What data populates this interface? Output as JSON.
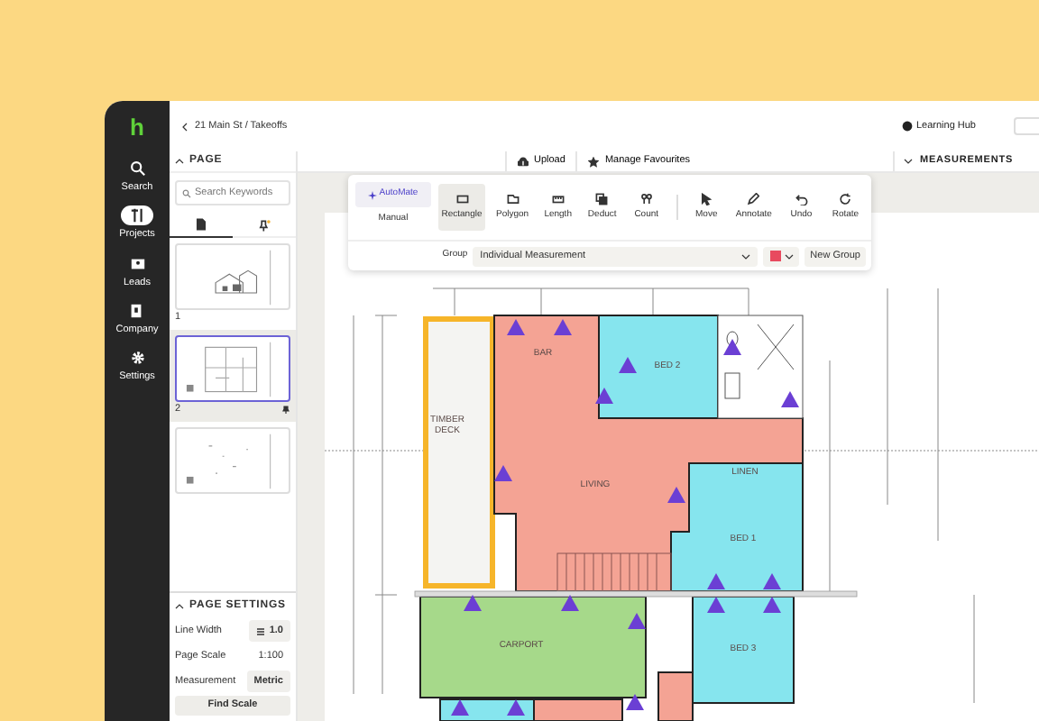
{
  "logo": "h",
  "nav": [
    {
      "label": "Search",
      "kind": "search",
      "selected": false
    },
    {
      "label": "Projects",
      "kind": "projects",
      "selected": true
    },
    {
      "label": "Leads",
      "kind": "leads",
      "selected": false
    },
    {
      "label": "Company",
      "kind": "company",
      "selected": false
    },
    {
      "label": "Settings",
      "kind": "settings",
      "selected": false
    }
  ],
  "header": {
    "breadcrumb": "21 Main St / Takeoffs",
    "help": "Learning Hub"
  },
  "page_panel": {
    "title": "PAGE",
    "search_placeholder": "Search Keywords",
    "tabs": [
      {
        "kind": "pages",
        "selected": true
      },
      {
        "kind": "pins",
        "selected": false
      }
    ],
    "pages": [
      {
        "number": "1",
        "kind": "elevation",
        "selected": false,
        "pinned": false
      },
      {
        "number": "2",
        "kind": "plan",
        "selected": true,
        "pinned": true
      },
      {
        "kind": "sparse",
        "selected": false,
        "pinned": false
      }
    ]
  },
  "page_settings": {
    "title": "PAGE SETTINGS",
    "rows": [
      {
        "label": "Line Width",
        "value": "1.0",
        "kind": "line"
      },
      {
        "label": "Page Scale",
        "value": "1:100",
        "kind": "plain"
      },
      {
        "label": "Measurement",
        "value": "Metric",
        "kind": "select"
      }
    ],
    "button": "Find Scale"
  },
  "toolbar": {
    "actions": [
      {
        "label": "Upload",
        "kind": "upload"
      },
      {
        "label": "Manage Favourites",
        "kind": "star"
      }
    ],
    "panel_title": "MEASUREMENTS"
  },
  "tools": {
    "modes": [
      {
        "label": "AutoMate",
        "selected": true
      },
      {
        "label": "Manual",
        "selected": false
      }
    ],
    "measure_tools": [
      {
        "label": "Rectangle",
        "kind": "rectangle",
        "selected": true
      },
      {
        "label": "Polygon",
        "kind": "polygon",
        "selected": false
      },
      {
        "label": "Length",
        "kind": "length",
        "selected": false
      },
      {
        "label": "Deduct",
        "kind": "deduct",
        "selected": false
      },
      {
        "label": "Count",
        "kind": "count",
        "selected": false
      }
    ],
    "edit_tools": [
      {
        "label": "Move",
        "kind": "move",
        "selected": false
      },
      {
        "label": "Annotate",
        "kind": "annotate",
        "selected": false
      },
      {
        "label": "Undo",
        "kind": "undo",
        "selected": false
      },
      {
        "label": "Rotate",
        "kind": "rotate",
        "selected": false
      }
    ],
    "group_label": "Group",
    "group_value": "Individual Measurement",
    "new_group": "New Group"
  },
  "plan": {
    "areas": [
      {
        "color": "#f4f4f2",
        "selected": true
      },
      {
        "color": "#f4a394",
        "selected": false
      },
      {
        "color": "#86e5ee",
        "selected": false
      },
      {
        "color": "#86e5ee",
        "selected": false
      },
      {
        "color": "#a6d98a",
        "selected": false
      },
      {
        "color": "#86e5ee",
        "selected": false
      },
      {
        "color": "#86e5ee",
        "selected": false
      },
      {
        "color": "#f4a394",
        "selected": false
      },
      {
        "color": "#f4a394",
        "selected": false
      }
    ],
    "labels": [
      "BAR",
      "BED 2",
      "TIMBER DECK",
      "LIVING",
      "LINEN",
      "BED 1",
      "CARPORT",
      "BED 3"
    ]
  }
}
